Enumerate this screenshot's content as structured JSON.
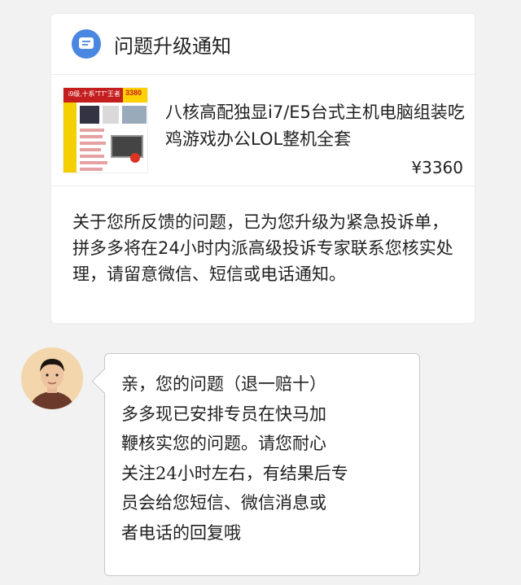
{
  "card": {
    "title": "问题升级通知",
    "icon": "message-icon",
    "accent_color": "#4a87e0"
  },
  "product": {
    "thumbnail_badge_text": "i9级,十系\"TT\"王者",
    "thumbnail_price_text": "3380",
    "title": "八核高配独显i7/E5台式主机电脑组装吃鸡游戏办公LOL整机全套",
    "price": "¥3360"
  },
  "notice": {
    "text": "关于您所反馈的问题，已为您升级为紧急投诉单，拼多多将在24小时内派高级投诉专家联系您核实处理，请留意微信、短信或电话通知。"
  },
  "reply": {
    "lines": [
      "亲，您的问题（退一赔十）",
      "多多现已安排专员在快马加",
      "鞭核实您的问题。请您耐心",
      "关注24小时左右，有结果后专",
      "员会给您短信、微信消息或",
      "者电话的回复哦"
    ]
  }
}
